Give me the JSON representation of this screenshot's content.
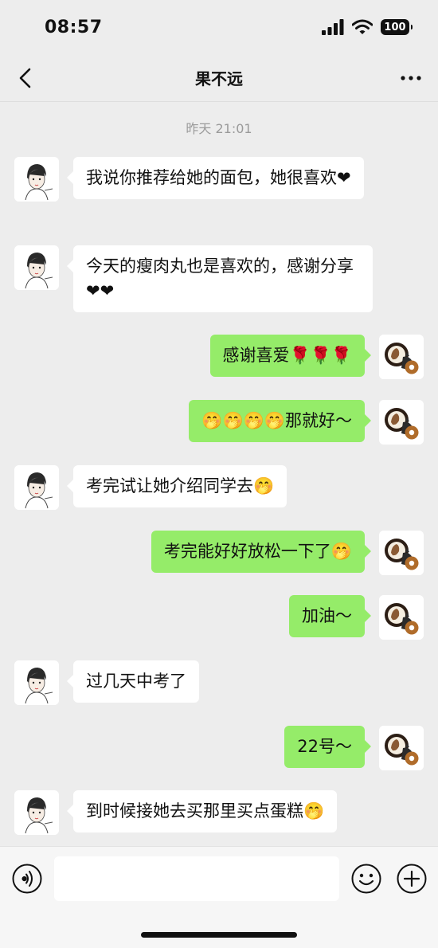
{
  "status_bar": {
    "time": "08:57",
    "battery": "100"
  },
  "header": {
    "title": "果不远"
  },
  "chat": {
    "timestamp": "昨天 21:01",
    "messages": [
      {
        "side": "left",
        "text": "我说你推荐给她的面包，她很喜欢❤"
      },
      {
        "side": "left",
        "text": "今天的瘦肉丸也是喜欢的，感谢分享❤❤"
      },
      {
        "side": "right",
        "text": "感谢喜爱🌹🌹🌹"
      },
      {
        "side": "right",
        "text": "🤭🤭🤭🤭那就好～"
      },
      {
        "side": "left",
        "text": "考完试让她介绍同学去🤭"
      },
      {
        "side": "right",
        "text": "考完能好好放松一下了🤭"
      },
      {
        "side": "right",
        "text": "加油～"
      },
      {
        "side": "left",
        "text": "过几天中考了"
      },
      {
        "side": "right",
        "text": "22号～"
      },
      {
        "side": "left",
        "text": "到时候接她去买那里买点蛋糕🤭"
      }
    ]
  },
  "input_bar": {
    "value": "",
    "placeholder": ""
  },
  "icons": {
    "back": "chevron-left-icon",
    "more": "more-dots-icon",
    "voice": "voice-icon",
    "emoji": "emoji-icon",
    "plus": "plus-icon"
  },
  "colors": {
    "background": "#ededed",
    "sent_bubble": "#95ec69",
    "received_bubble": "#ffffff"
  }
}
